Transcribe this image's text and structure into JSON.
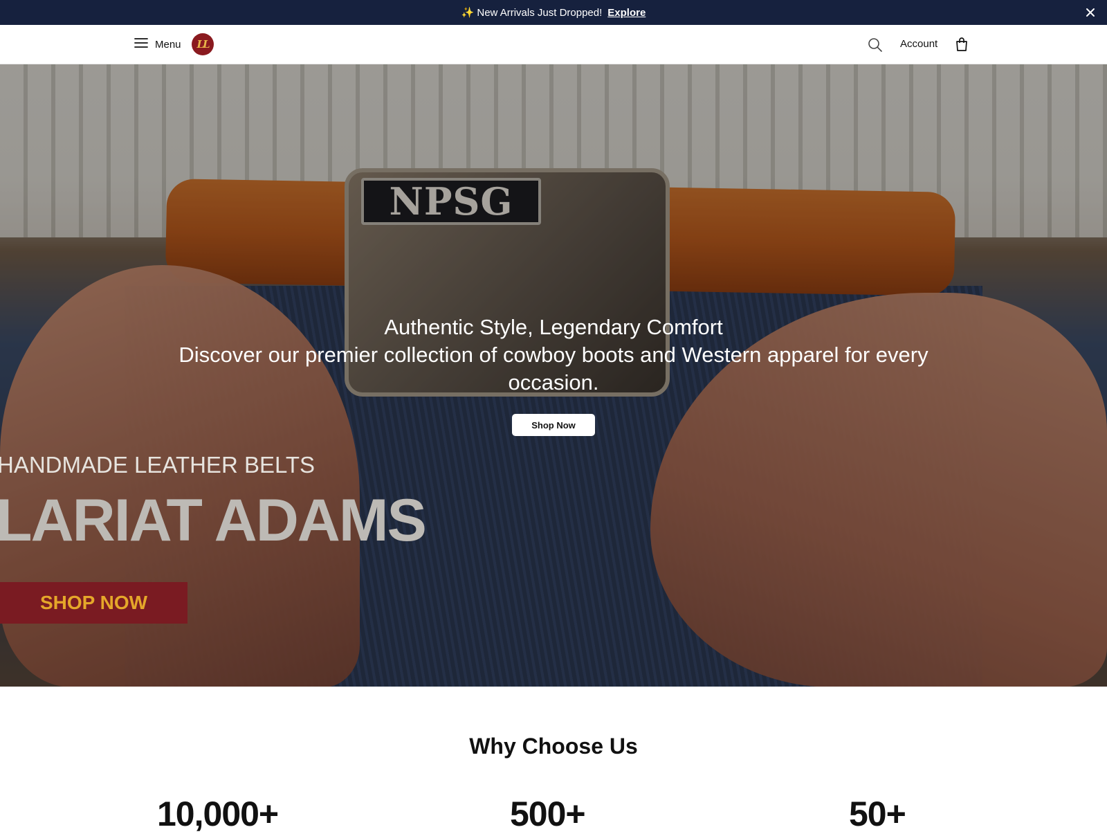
{
  "announcement": {
    "emoji": "✨",
    "text": "New Arrivals Just Dropped!",
    "link": "Explore"
  },
  "header": {
    "menu_label": "Menu",
    "logo_text": "LL",
    "account_label": "Account",
    "icons": [
      "menu-icon",
      "search-icon",
      "shopping-bag-icon",
      "close-icon"
    ]
  },
  "hero": {
    "title": "Authentic Style, Legendary Comfort",
    "subtitle": "Discover our premier collection of cowboy boots and Western apparel for every occasion.",
    "cta": "Shop Now",
    "buckle_text": "NPSG",
    "promo": {
      "kicker": "HANDMADE LEATHER BELTS",
      "brand": "LARIAT ADAMS",
      "cta": "SHOP NOW"
    }
  },
  "why_choose_us": {
    "title": "Why Choose Us",
    "stats": [
      "10,000+",
      "500+",
      "50+"
    ]
  },
  "colors": {
    "announcement_bg": "#16213e",
    "brand_red": "#7a1b22",
    "brand_gold": "#e5a72a"
  }
}
